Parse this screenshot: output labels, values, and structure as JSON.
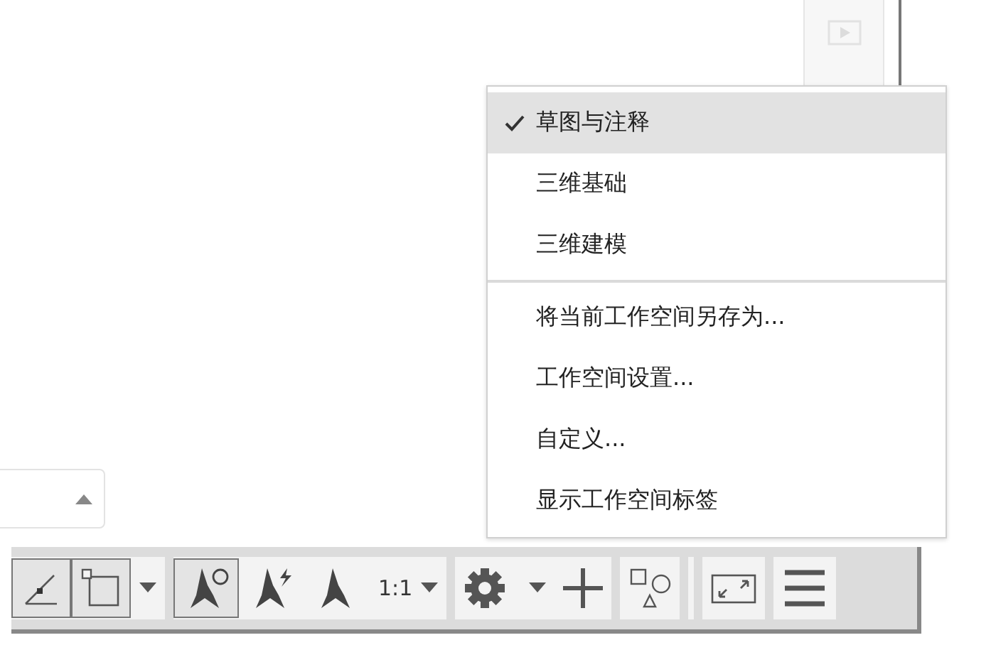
{
  "workspace_menu": {
    "workspaces": [
      {
        "label": "草图与注释",
        "selected": true
      },
      {
        "label": "三维基础",
        "selected": false
      },
      {
        "label": "三维建模",
        "selected": false
      }
    ],
    "actions": [
      {
        "label": "将当前工作空间另存为..."
      },
      {
        "label": "工作空间设置..."
      },
      {
        "label": "自定义..."
      },
      {
        "label": "显示工作空间标签"
      }
    ]
  },
  "status_toolbar": {
    "buttons": [
      {
        "kind": "angle",
        "on": true
      },
      {
        "kind": "snap",
        "on": true
      },
      {
        "kind": "caret"
      },
      {
        "kind": "annotation",
        "on": true
      },
      {
        "kind": "annotation-bolt",
        "on": false
      },
      {
        "kind": "annotation-plain",
        "on": false
      },
      {
        "kind": "scale",
        "label": "1:1"
      },
      {
        "kind": "gear"
      },
      {
        "kind": "plus"
      },
      {
        "kind": "shapes"
      },
      {
        "kind": "fullscreen"
      },
      {
        "kind": "menu"
      }
    ]
  }
}
